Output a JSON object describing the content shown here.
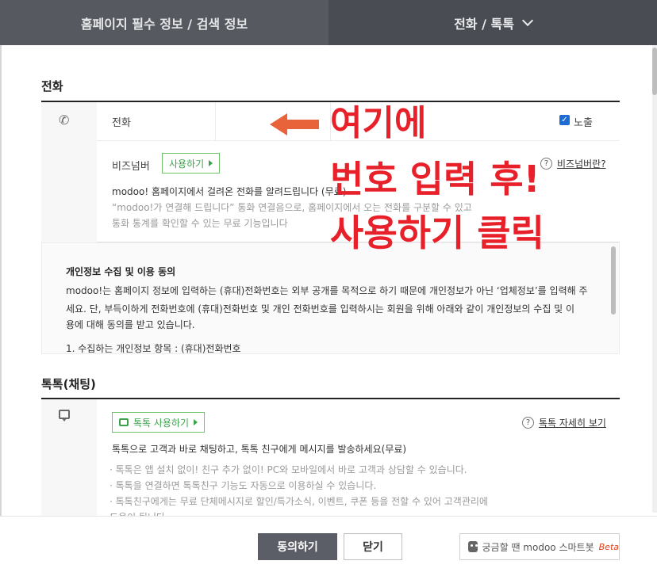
{
  "tabs": {
    "active": "홈페이지 필수 정보 / 검색 정보",
    "other": "전화 / 톡톡"
  },
  "phone_section": {
    "title": "전화",
    "phone_label": "전화",
    "expose_label": "노출",
    "biz_label": "비즈넘버",
    "use_button": "사용하기",
    "help_link": "비즈넘버란?",
    "desc_main": "modoo! 홈페이지에서 걸려온 전화를 알려드립니다 (무료)",
    "desc_sub1": "“modoo!가 연결해 드립니다” 통화 연결음으로, 홈페이지에서 오는 전화를 구분할 수 있고",
    "desc_sub2": "통화 통계를 확인할 수 있는 무료 기능입니다"
  },
  "consent": {
    "title": "개인정보 수집 및 이용 동의",
    "line1": "modoo!는 홈페이지 정보에 입력하는 (휴대)전화번호는 외부 공개를 목적으로 하기 때문에 개인정보가 아닌 ‘업체정보’를 입력해 주",
    "line2": "세요. 단, 부득이하게 전화번호에 (휴대)전화번호 및 개인 전화번호를 입력하시는 회원을 위해 아래와 같이 개인정보의 수집 및 이",
    "line3": "용에 대해 동의를 받고 있습니다.",
    "item1": "1. 수집하는 개인정보 항목 : (휴대)전화번호"
  },
  "talk_section": {
    "title": "톡톡(채팅)",
    "use_button": "톡톡 사용하기",
    "help_link": "톡톡 자세히 보기",
    "desc_main": "톡톡으로 고객과 바로 채팅하고, 톡톡 친구에게 메시지를 발송하세요(무료)",
    "bullet1": "· 톡톡은 앱 설치 없이! 친구 추가 없이! PC와 모바일에서 바로 고객과 상담할 수 있습니다.",
    "bullet2": "· 톡톡을 연결하면 톡톡친구 기능도 자동으로 이용하실 수 있습니다.",
    "bullet3": "· 톡톡친구에게는 무료 단체메시지로 할인/특가소식, 이벤트, 쿠폰 등을 전할 수 있어 고객관리에",
    "bullet4": "  도움이 됩니다."
  },
  "footer": {
    "agree": "동의하기",
    "close": "닫기",
    "bot_text": "궁금할 땐 modoo 스마트봇",
    "bot_beta": "Beta"
  },
  "annotation": {
    "line1": "여기에",
    "line2": "번호 입력 후!",
    "line3": "사용하기 클릭",
    "color": "#e8202a"
  }
}
